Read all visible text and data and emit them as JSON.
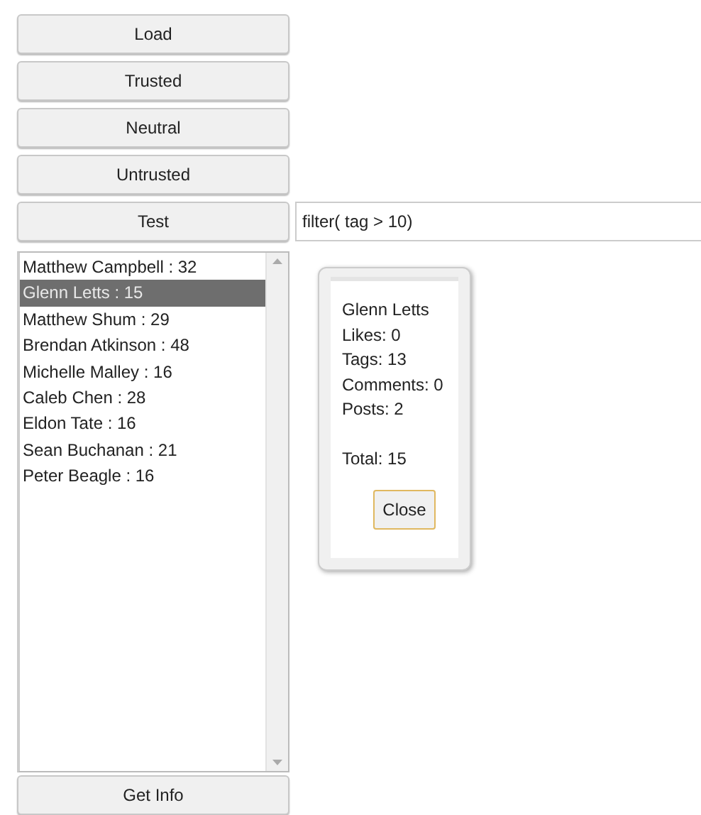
{
  "buttons": [
    "Load",
    "Trusted",
    "Neutral",
    "Untrusted"
  ],
  "test": {
    "button": "Test",
    "query": "filter( tag > 10)"
  },
  "users": [
    {
      "label": "Matthew Campbell : 32",
      "selected": false
    },
    {
      "label": "Glenn Letts : 15",
      "selected": true
    },
    {
      "label": "Matthew Shum : 29",
      "selected": false
    },
    {
      "label": "Brendan Atkinson : 48",
      "selected": false
    },
    {
      "label": "Michelle Malley : 16",
      "selected": false
    },
    {
      "label": "Caleb Chen : 28",
      "selected": false
    },
    {
      "label": "Eldon Tate : 16",
      "selected": false
    },
    {
      "label": "Sean Buchanan : 21",
      "selected": false
    },
    {
      "label": "Peter Beagle : 16",
      "selected": false
    }
  ],
  "info_popup": {
    "name": "Glenn Letts",
    "stats": [
      "Likes: 0",
      "Tags: 13",
      "Comments: 0",
      "Posts: 2"
    ],
    "total": "Total: 15",
    "close": "Close"
  },
  "get_info": "Get Info"
}
